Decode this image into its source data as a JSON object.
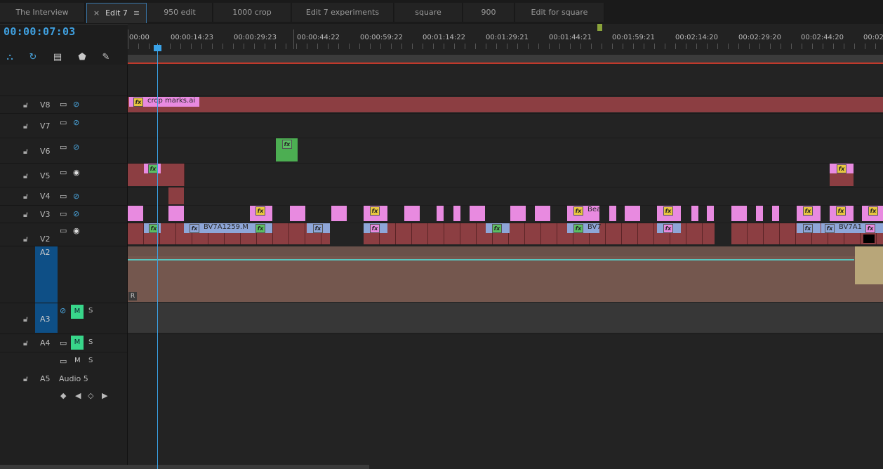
{
  "tabs": [
    {
      "label": "The Interview"
    },
    {
      "label": "Edit 7",
      "active": true
    },
    {
      "label": "950 edit"
    },
    {
      "label": "1000 crop"
    },
    {
      "label": "Edit 7 experiments"
    },
    {
      "label": "square"
    },
    {
      "label": "900"
    },
    {
      "label": "Edit for square"
    }
  ],
  "tab_close": "×",
  "tab_menu": "≡",
  "timecode": "00:00:07:03",
  "ruler_labels": [
    "00:00",
    "00:00:14:23",
    "00:00:29:23",
    "00:00:44:22",
    "00:00:59:22",
    "00:01:14:22",
    "00:01:29:21",
    "00:01:44:21",
    "00:01:59:21",
    "00:02:14:20",
    "00:02:29:20",
    "00:02:44:20",
    "00:02"
  ],
  "tracks": {
    "v8": "V8",
    "v7": "V7",
    "v6": "V6",
    "v5": "V5",
    "v4": "V4",
    "v3": "V3",
    "v2": "V2",
    "a2": "A2",
    "a3": "A3",
    "a4": "A4",
    "a5": "A5",
    "audio5": "Audio 5"
  },
  "mute": "M",
  "solo": "S",
  "clips": {
    "crop_marks": "crop marks.ai",
    "bv1": "BV7A1259.M",
    "bea": "Bea",
    "bv7": "BV7",
    "bv7a1": "BV7A1"
  },
  "audio_badge": "R",
  "fx_label": "fx",
  "colors": {
    "accent": "#3aa3e8",
    "video_clip": "#e88ae0",
    "audio_clip": "#8c3e42",
    "selected_track": "#0e4f86",
    "mute_on": "#38d68a"
  }
}
